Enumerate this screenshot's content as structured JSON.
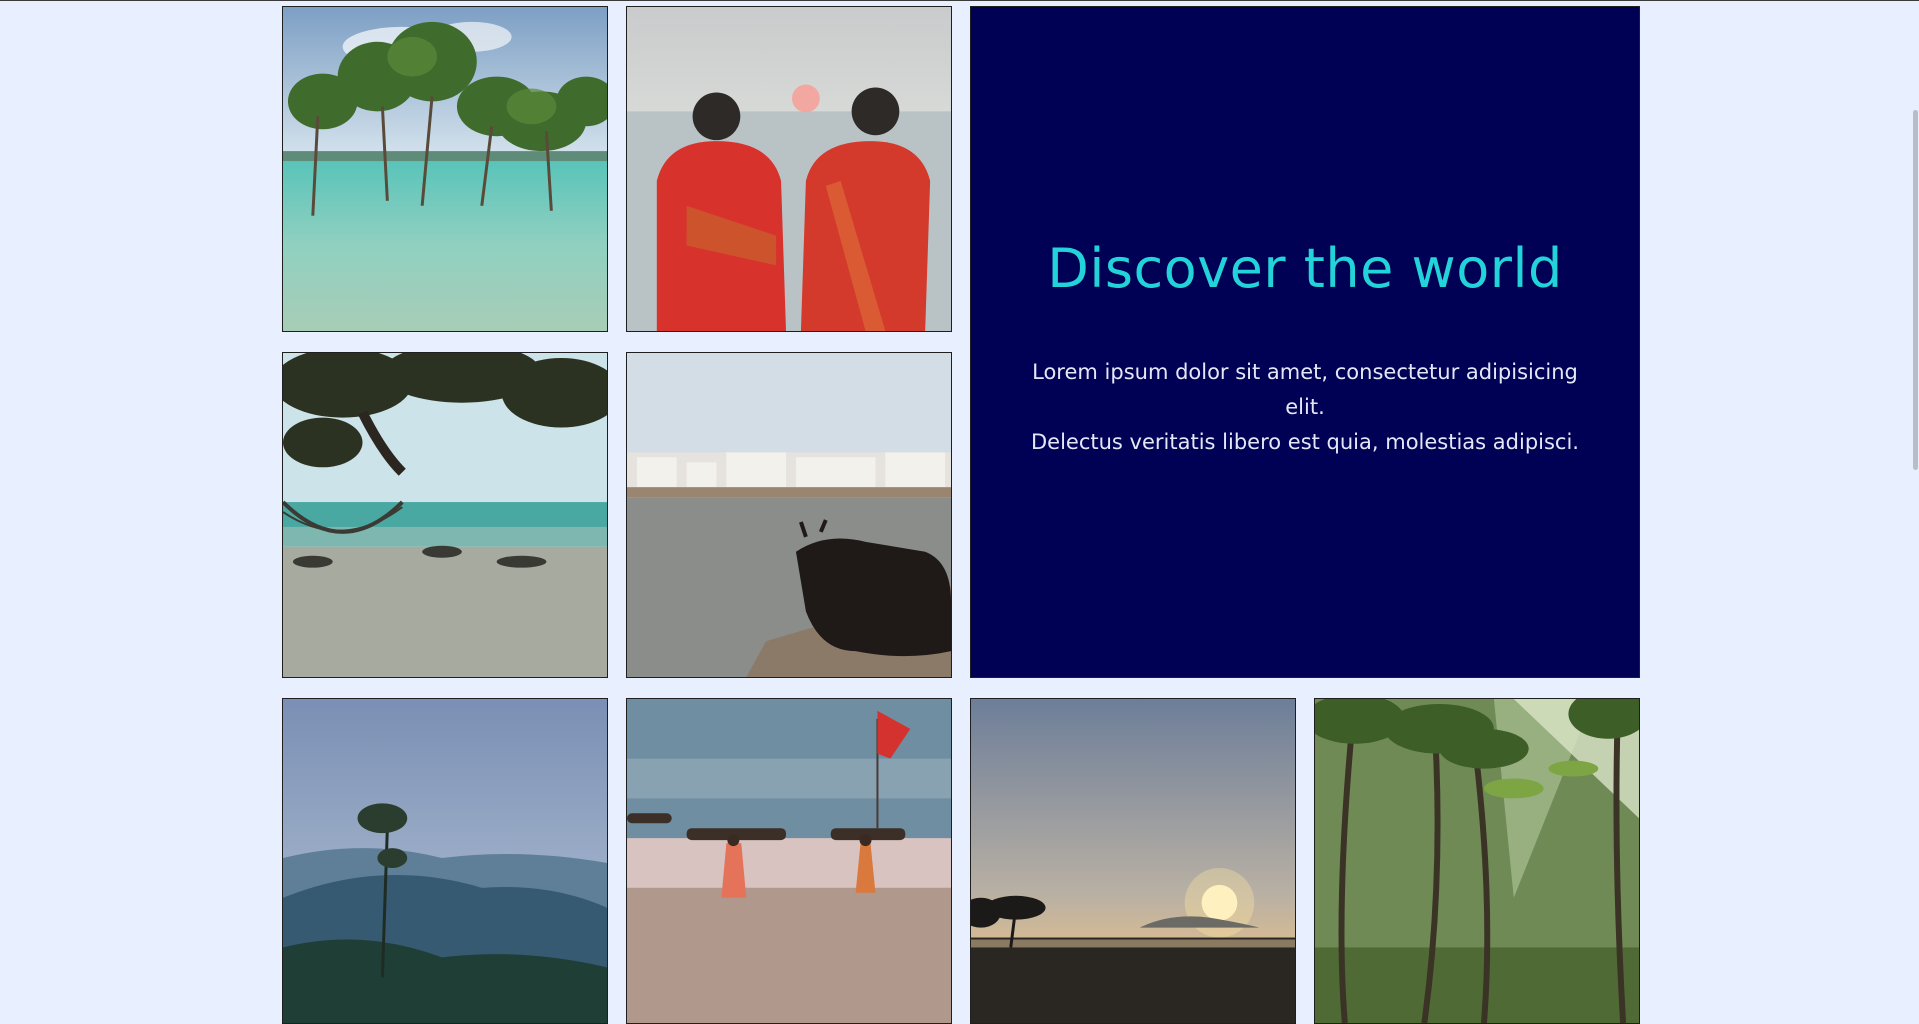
{
  "hero": {
    "title": "Discover the world",
    "body_line1": "Lorem ipsum dolor sit amet, consectetur adipisicing elit.",
    "body_line2": "Delectus veritatis libero est quia, molestias adipisci.",
    "background_color": "#000055",
    "title_color": "#22d3d9"
  },
  "gallery": {
    "photos": [
      {
        "name": "mangrove-trees-in-sea-photo"
      },
      {
        "name": "two-women-red-saris-sunset-photo"
      },
      {
        "name": "beach-with-hammock-photo"
      },
      {
        "name": "white-town-lake-with-cow-photo"
      },
      {
        "name": "misty-hills-lone-tree-photo"
      },
      {
        "name": "people-carrying-wood-on-beach-photo"
      },
      {
        "name": "sunset-over-tidal-flats-photo"
      },
      {
        "name": "palm-grove-sunbeams-photo"
      }
    ]
  },
  "colors": {
    "page_background": "#e8efff",
    "tile_border": "#1f1f1f"
  }
}
